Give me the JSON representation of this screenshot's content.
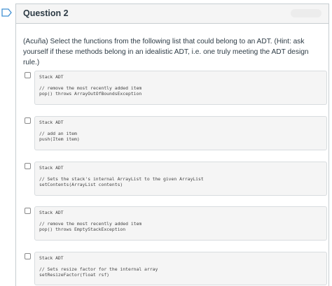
{
  "question": {
    "title": "Question 2",
    "text": "(Acuña) Select the functions from the following list that could belong to an ADT. (Hint: ask yourself if these methods belong in an idealistic ADT, i.e. one truly meeting the ADT design rule.)"
  },
  "answers": [
    {
      "lines": [
        "Stack ADT",
        "",
        "// remove the most recently added item",
        "pop() throws ArrayOutOfBoundsException"
      ],
      "checked": false
    },
    {
      "lines": [
        "Stack ADT",
        "",
        "// add an item",
        "push(Item item)"
      ],
      "checked": false
    },
    {
      "lines": [
        "Stack ADT",
        "",
        "// Sets the stack's internal ArrayList to the given ArrayList",
        "setContents(ArrayList contents)"
      ],
      "checked": false
    },
    {
      "lines": [
        "Stack ADT",
        "",
        "// remove the most recently added item",
        "pop() throws EmptyStackException"
      ],
      "checked": false
    },
    {
      "lines": [
        "Stack ADT",
        "",
        "// Sets resize factor for the internal array",
        "setResizeFactor(float rsf)"
      ],
      "checked": false
    }
  ],
  "colors": {
    "flag_outline": "#3f8fd2",
    "header_bg": "#f5f5f5",
    "answer_bg": "#f5f5f5"
  },
  "icons": {
    "flag": "bookmark-flag-icon",
    "checkbox": "checkbox-icon"
  }
}
